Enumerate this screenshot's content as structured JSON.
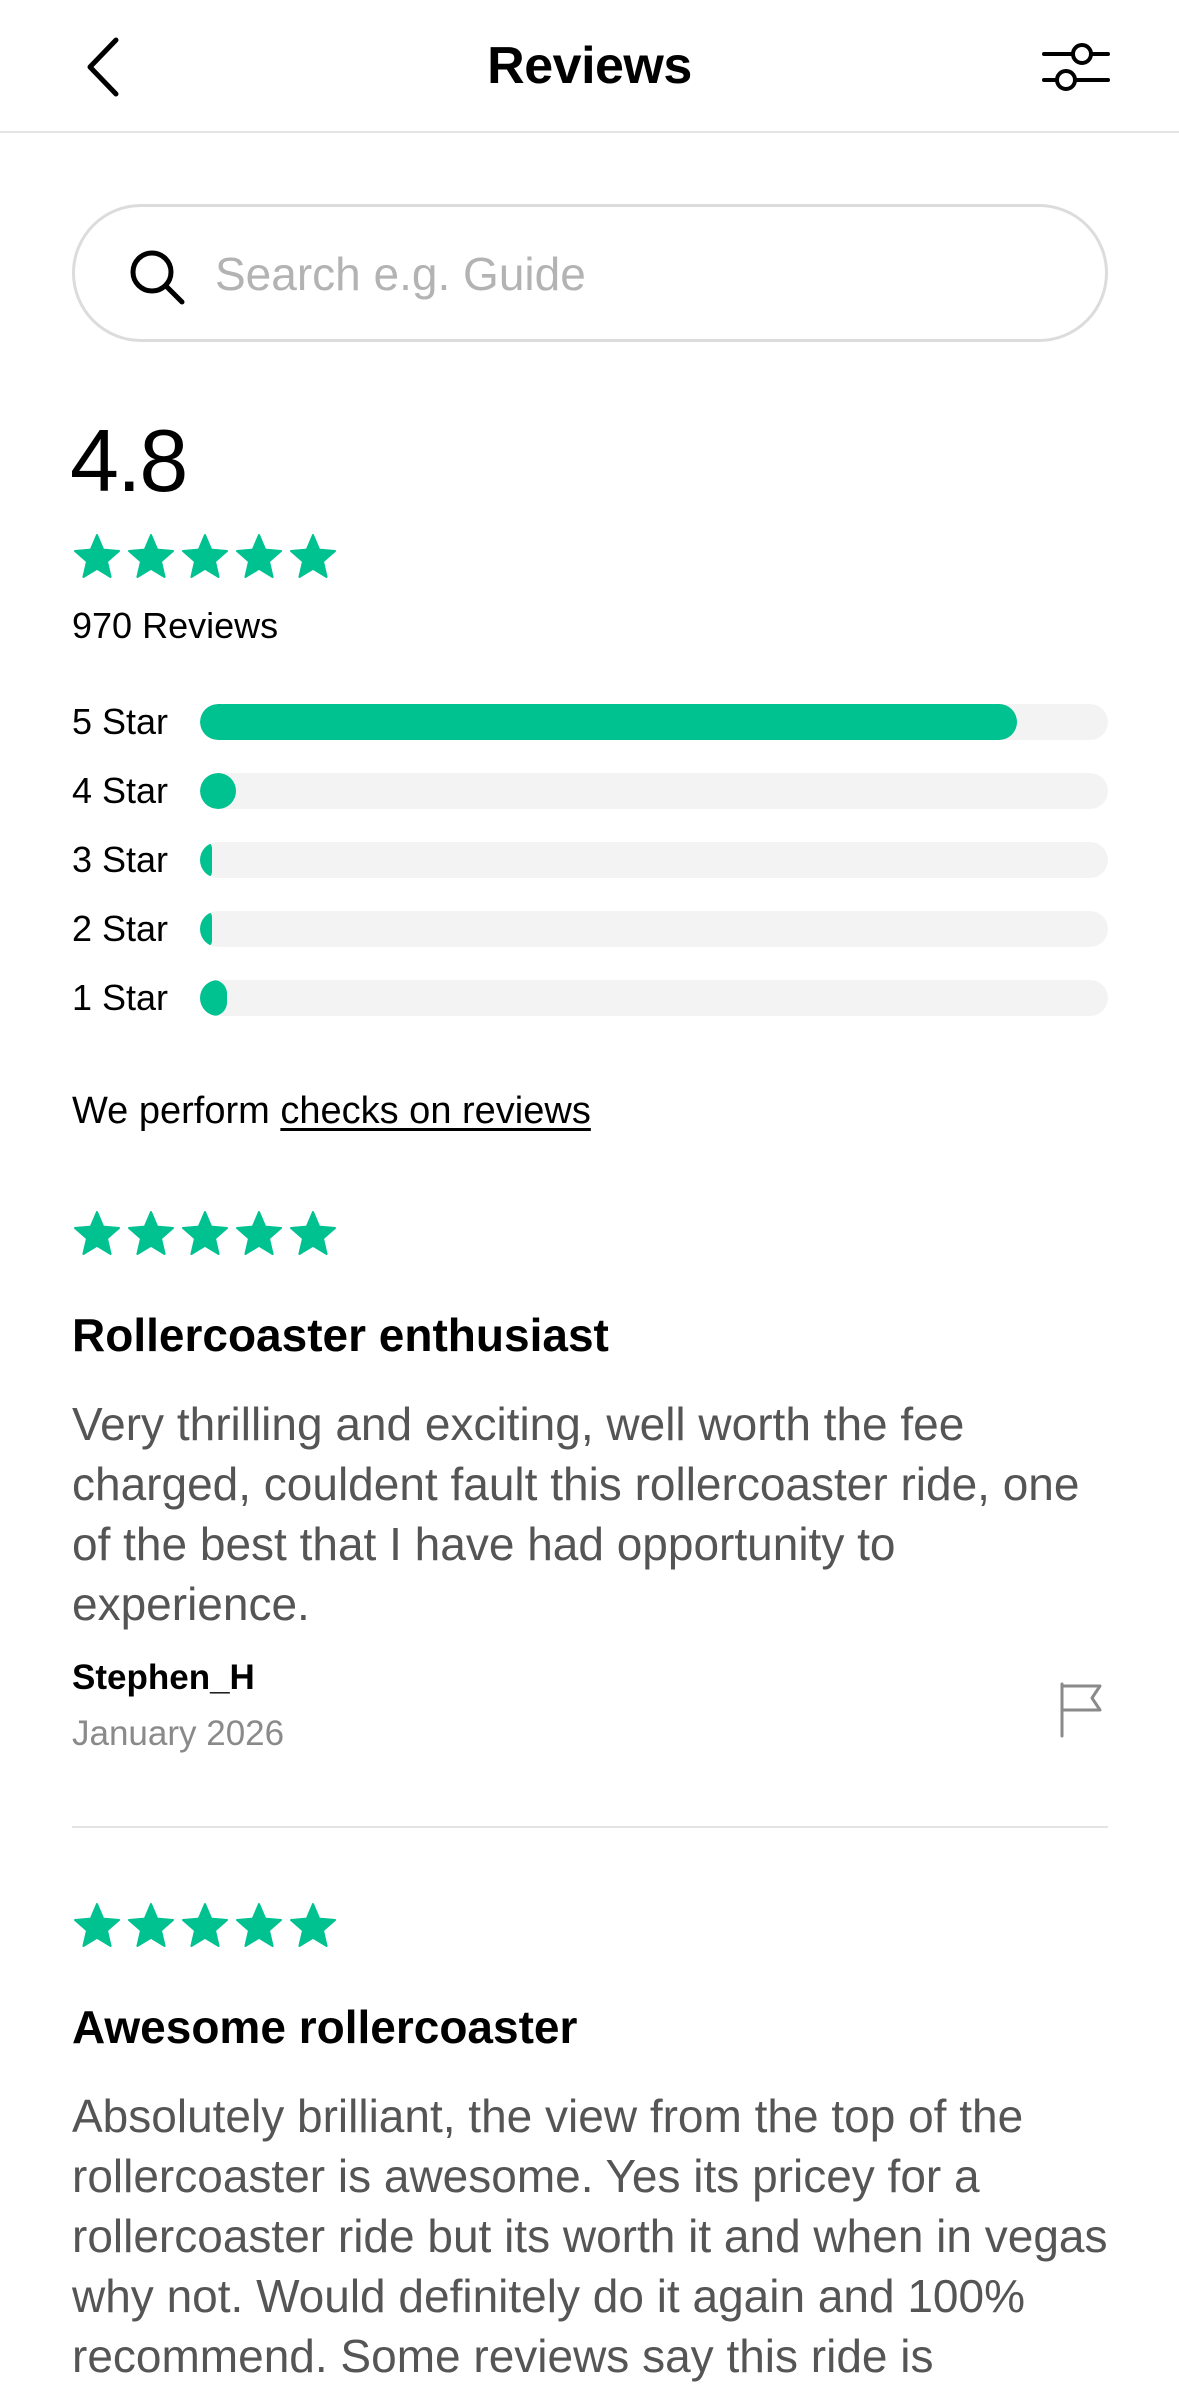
{
  "header": {
    "title": "Reviews"
  },
  "search": {
    "placeholder": "Search e.g. Guide",
    "value": ""
  },
  "summary": {
    "rating": "4.8",
    "review_count": "970 Reviews",
    "star_color": "#00c190",
    "distribution": [
      {
        "label": "5 Star",
        "fraction": 0.9
      },
      {
        "label": "4 Star",
        "fraction": 0.04
      },
      {
        "label": "3 Star",
        "fraction": 0.01
      },
      {
        "label": "2 Star",
        "fraction": 0.01
      },
      {
        "label": "1 Star",
        "fraction": 0.03
      }
    ]
  },
  "checks": {
    "prefix": "We perform ",
    "link": "checks on reviews"
  },
  "reviews": [
    {
      "stars": 5,
      "title": "Rollercoaster enthusiast",
      "body": "Very thrilling and exciting, well worth the fee charged, couldent fault this rollercoaster ride, one of the best that I have had opportunity to experience.",
      "author": "Stephen_H",
      "date": "January 2026"
    },
    {
      "stars": 5,
      "title": "Awesome rollercoaster",
      "body": "Absolutely brilliant, the view from the top of the rollercoaster is awesome. Yes its pricey for a rollercoaster ride but its worth it and when in vegas why not. Would definitely do it again and 100% recommend. Some reviews say this ride is"
    }
  ],
  "icons": {
    "back": "chevron-left-icon",
    "filter": "sliders-icon",
    "search": "search-icon",
    "star": "star-icon",
    "flag": "flag-icon"
  }
}
